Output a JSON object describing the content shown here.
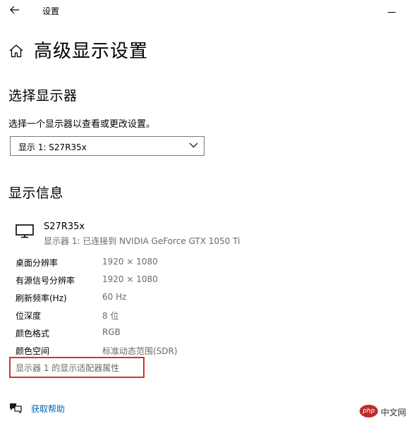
{
  "window": {
    "title": "设置",
    "back_icon": "arrow-left-icon",
    "minimize_icon": "minimize-icon"
  },
  "header": {
    "home_icon": "home-icon",
    "title": "高级显示设置"
  },
  "select_display": {
    "heading": "选择显示器",
    "subtitle": "选择一个显示器以查看或更改设置。",
    "selected_value": "显示 1: S27R35x",
    "chevron_icon": "chevron-down-icon"
  },
  "display_info": {
    "heading": "显示信息",
    "monitor_icon": "monitor-icon",
    "monitor_name": "S27R35x",
    "connection": "显示器 1: 已连接到 NVIDIA GeForce GTX 1050 Ti",
    "rows": [
      {
        "label": "桌面分辨率",
        "value": "1920 × 1080"
      },
      {
        "label": "有源信号分辨率",
        "value": "1920 × 1080"
      },
      {
        "label": "刷新频率(Hz)",
        "value": "60 Hz"
      },
      {
        "label": "位深度",
        "value": "8 位"
      },
      {
        "label": "颜色格式",
        "value": "RGB"
      },
      {
        "label": "颜色空间",
        "value": "标准动态范围(SDR)"
      }
    ],
    "adapter_link": "显示器 1 的显示适配器属性",
    "highlight_color": "#d92f2f"
  },
  "help": {
    "icon": "help-chat-icon",
    "label": "获取帮助",
    "color": "#0063b1"
  },
  "watermark": {
    "logo_text": "php",
    "text": "中文网"
  }
}
